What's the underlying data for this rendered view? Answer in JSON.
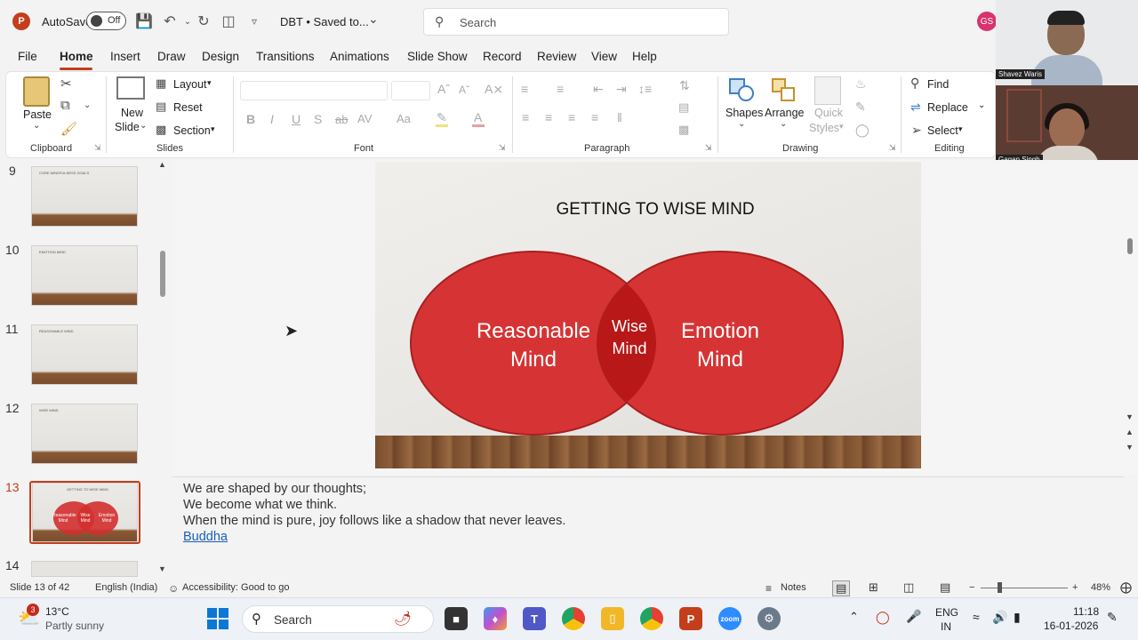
{
  "titlebar": {
    "autosave_label": "AutoSave",
    "autosave_state": "Off",
    "doc_title": "DBT • Saved to...",
    "search_placeholder": "Search",
    "user_initials": "GS"
  },
  "menu": [
    "File",
    "Home",
    "Insert",
    "Draw",
    "Design",
    "Transitions",
    "Animations",
    "Slide Show",
    "Record",
    "Review",
    "View",
    "Help"
  ],
  "ribbon": {
    "clipboard": {
      "paste": "Paste",
      "group": "Clipboard"
    },
    "slides": {
      "new_slide_1": "New",
      "new_slide_2": "Slide",
      "layout": "Layout",
      "reset": "Reset",
      "section": "Section",
      "group": "Slides"
    },
    "font": {
      "group": "Font"
    },
    "paragraph": {
      "group": "Paragraph"
    },
    "drawing": {
      "shapes": "Shapes",
      "arrange": "Arrange",
      "quick_styles_1": "Quick",
      "quick_styles_2": "Styles",
      "group": "Drawing"
    },
    "editing": {
      "find": "Find",
      "replace": "Replace",
      "select": "Select",
      "group": "Editing"
    }
  },
  "webcam": {
    "participant_1": "Shavez Waris",
    "participant_2": "Gagan Singh"
  },
  "thumbnails": [
    {
      "num": "9",
      "text": "CORE MINDFULNESS GOALS"
    },
    {
      "num": "10",
      "text": "EMOTION MIND"
    },
    {
      "num": "11",
      "text": "REASONABLE MIND"
    },
    {
      "num": "12",
      "text": "WISE MIND"
    },
    {
      "num": "13",
      "text": "GETTING TO WISE MIND",
      "left": "Reasonable Mind",
      "center": "Wise Mind",
      "right": "Emotion Mind"
    },
    {
      "num": "14",
      "text": ""
    }
  ],
  "slide": {
    "title": "GETTING TO WISE MIND",
    "left_circle_1": "Reasonable",
    "left_circle_2": "Mind",
    "center_1": "Wise",
    "center_2": "Mind",
    "right_circle_1": "Emotion",
    "right_circle_2": "Mind",
    "circle_color": "#d32f2f"
  },
  "notes": {
    "line1": "We are shaped by our thoughts;",
    "line2": "We become what we think.",
    "line3": "When the mind is pure, joy follows like a shadow that never leaves.",
    "link": "Buddha"
  },
  "status": {
    "slide_info": "Slide 13 of 42",
    "language": "English (India)",
    "accessibility": "Accessibility: Good to go",
    "notes_btn": "Notes",
    "zoom": "48%"
  },
  "taskbar": {
    "weather_badge": "3",
    "temp": "13°C",
    "weather": "Partly sunny",
    "search": "Search",
    "lang_1": "ENG",
    "lang_2": "IN",
    "time": "11:18",
    "date": "16-01-2026"
  }
}
